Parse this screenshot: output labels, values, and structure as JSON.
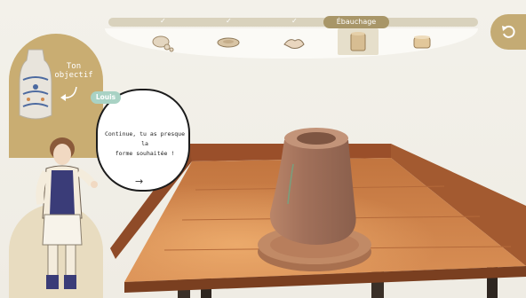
{
  "steps": {
    "checks": [
      "✓",
      "✓",
      "✓"
    ],
    "active_label": "Ébauchage",
    "items": [
      {
        "icon": "clay-ball-icon"
      },
      {
        "icon": "clay-disc-icon"
      },
      {
        "icon": "hands-icon"
      },
      {
        "icon": "rough-pot-icon"
      },
      {
        "icon": "finished-pot-icon"
      }
    ]
  },
  "undo": {
    "icon": "undo-icon"
  },
  "objective": {
    "label_line1": "Ton",
    "label_line2": "objectif",
    "image": "target-vase-image"
  },
  "character": {
    "name": "Louis"
  },
  "dialogue": {
    "line1": "Continue, tu as presque la",
    "line2": "forme souhaitée !",
    "arrow": "→"
  },
  "colors": {
    "accent": "#c4ab74",
    "badge": "#a9d2c4",
    "table": "#c47a4a",
    "clay": "#b8836a"
  }
}
